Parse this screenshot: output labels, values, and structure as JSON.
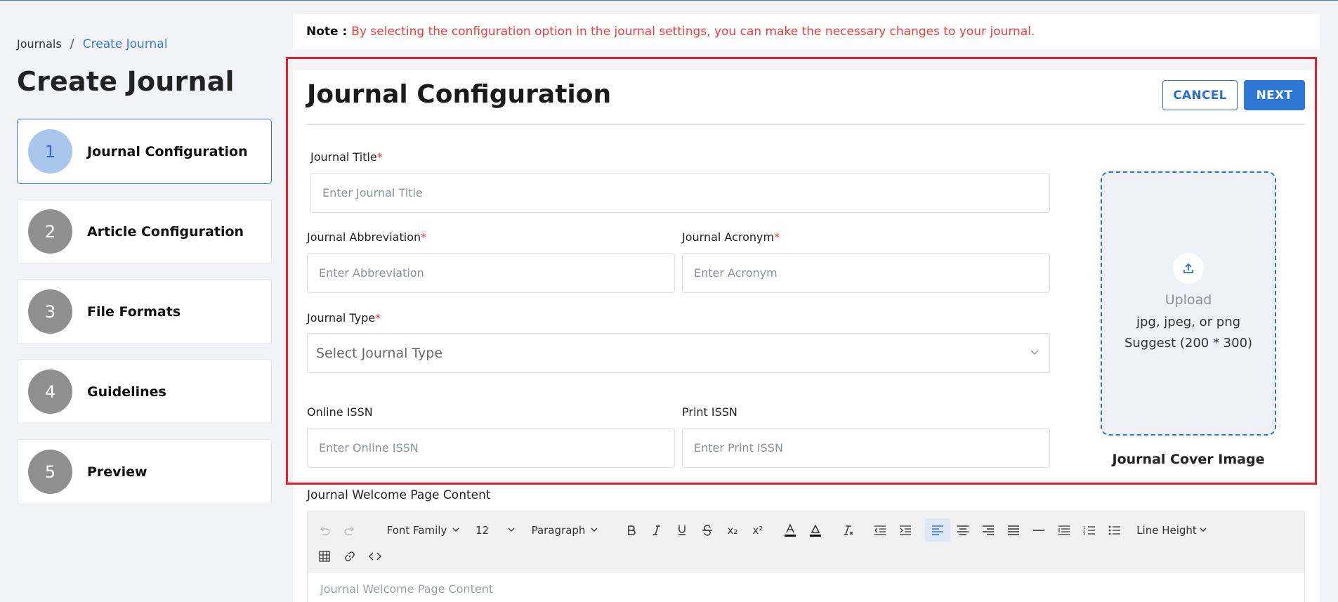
{
  "breadcrumb": {
    "root": "Journals",
    "separator": "/",
    "current": "Create Journal"
  },
  "page_title": "Create Journal",
  "steps": [
    {
      "number": "1",
      "label": "Journal Configuration",
      "active": true
    },
    {
      "number": "2",
      "label": "Article Configuration",
      "active": false
    },
    {
      "number": "3",
      "label": "File Formats",
      "active": false
    },
    {
      "number": "4",
      "label": "Guidelines",
      "active": false
    },
    {
      "number": "5",
      "label": "Preview",
      "active": false
    }
  ],
  "note": {
    "label": "Note :",
    "text": "By selecting the configuration option in the journal settings, you can make the necessary changes to your journal."
  },
  "section_title": "Journal Configuration",
  "buttons": {
    "cancel": "CANCEL",
    "next": "NEXT"
  },
  "form": {
    "journal_title": {
      "label": "Journal Title",
      "required": "*",
      "placeholder": "Enter Journal Title"
    },
    "abbreviation": {
      "label": "Journal Abbreviation",
      "required": "*",
      "placeholder": "Enter Abbreviation"
    },
    "acronym": {
      "label": "Journal Acronym",
      "required": "*",
      "placeholder": "Enter Acronym"
    },
    "journal_type": {
      "label": "Journal Type",
      "required": "*",
      "placeholder": "Select Journal Type"
    },
    "online_issn": {
      "label": "Online ISSN",
      "placeholder": "Enter Online ISSN"
    },
    "print_issn": {
      "label": "Print ISSN",
      "placeholder": "Enter Print ISSN"
    }
  },
  "upload": {
    "title": "Upload",
    "formats": "jpg, jpeg, or png",
    "suggest": "Suggest (200 * 300)",
    "caption": "Journal Cover Image"
  },
  "editor": {
    "label": "Journal Welcome Page Content",
    "placeholder": "Journal Welcome Page Content",
    "font_family": "Font Family",
    "font_size": "12",
    "block_format": "Paragraph",
    "line_height": "Line Height",
    "superscript_glyph": "x²",
    "subscript_glyph": "x₂"
  },
  "colors": {
    "accent": "#2f77d4",
    "danger": "#ef3b3b",
    "highlight_border": "#e41e2a",
    "step_inactive": "#8f8f8f"
  }
}
